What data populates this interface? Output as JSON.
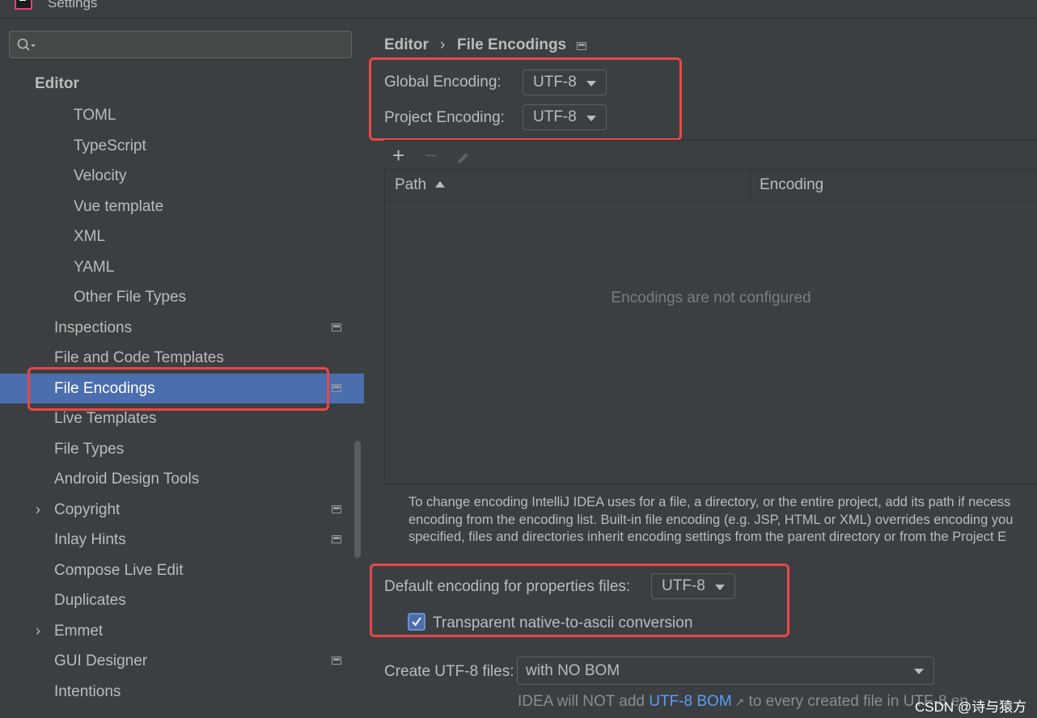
{
  "window": {
    "title": "Settings"
  },
  "search": {
    "placeholder": ""
  },
  "sidebar": {
    "items": [
      {
        "label": "Editor",
        "heading": true
      },
      {
        "label": "TOML"
      },
      {
        "label": "TypeScript"
      },
      {
        "label": "Velocity"
      },
      {
        "label": "Vue template"
      },
      {
        "label": "XML"
      },
      {
        "label": "YAML"
      },
      {
        "label": "Other File Types"
      },
      {
        "label": "Inspections"
      },
      {
        "label": "File and Code Templates"
      },
      {
        "label": "File Encodings",
        "selected": true
      },
      {
        "label": "Live Templates"
      },
      {
        "label": "File Types"
      },
      {
        "label": "Android Design Tools"
      },
      {
        "label": "Copyright"
      },
      {
        "label": "Inlay Hints"
      },
      {
        "label": "Compose Live Edit"
      },
      {
        "label": "Duplicates"
      },
      {
        "label": "Emmet"
      },
      {
        "label": "GUI Designer"
      },
      {
        "label": "Intentions"
      }
    ]
  },
  "breadcrumb": {
    "parent": "Editor",
    "separator": "›",
    "current": "File Encodings"
  },
  "global_encoding": {
    "label": "Global Encoding:",
    "value": "UTF-8"
  },
  "project_encoding": {
    "label": "Project Encoding:",
    "value": "UTF-8"
  },
  "toolbar": {
    "add": "+",
    "remove": "−"
  },
  "table": {
    "columns": [
      "Path",
      "Encoding"
    ],
    "empty_text": "Encodings are not configured"
  },
  "help_text": [
    "To change encoding IntelliJ IDEA uses for a file, a directory, or the entire project, add its path if necess",
    "encoding from the encoding list. Built-in file encoding (e.g. JSP, HTML or XML) overrides encoding you",
    "specified, files and directories inherit encoding settings from the parent directory or from the Project E"
  ],
  "properties_encoding": {
    "label": "Default encoding for properties files:",
    "value": "UTF-8"
  },
  "native_to_ascii": {
    "label": "Transparent native-to-ascii conversion",
    "checked": true
  },
  "create_utf8": {
    "label": "Create UTF-8 files:",
    "value": "with NO BOM"
  },
  "footer": {
    "before": "IDEA will NOT add ",
    "link": "UTF-8 BOM",
    "after": " to every created file in UTF-8 en"
  },
  "watermark": "CSDN @诗与猿方",
  "colors": {
    "selection": "#4b6eaf",
    "highlight_box": "#e8474a",
    "link": "#589df6"
  }
}
